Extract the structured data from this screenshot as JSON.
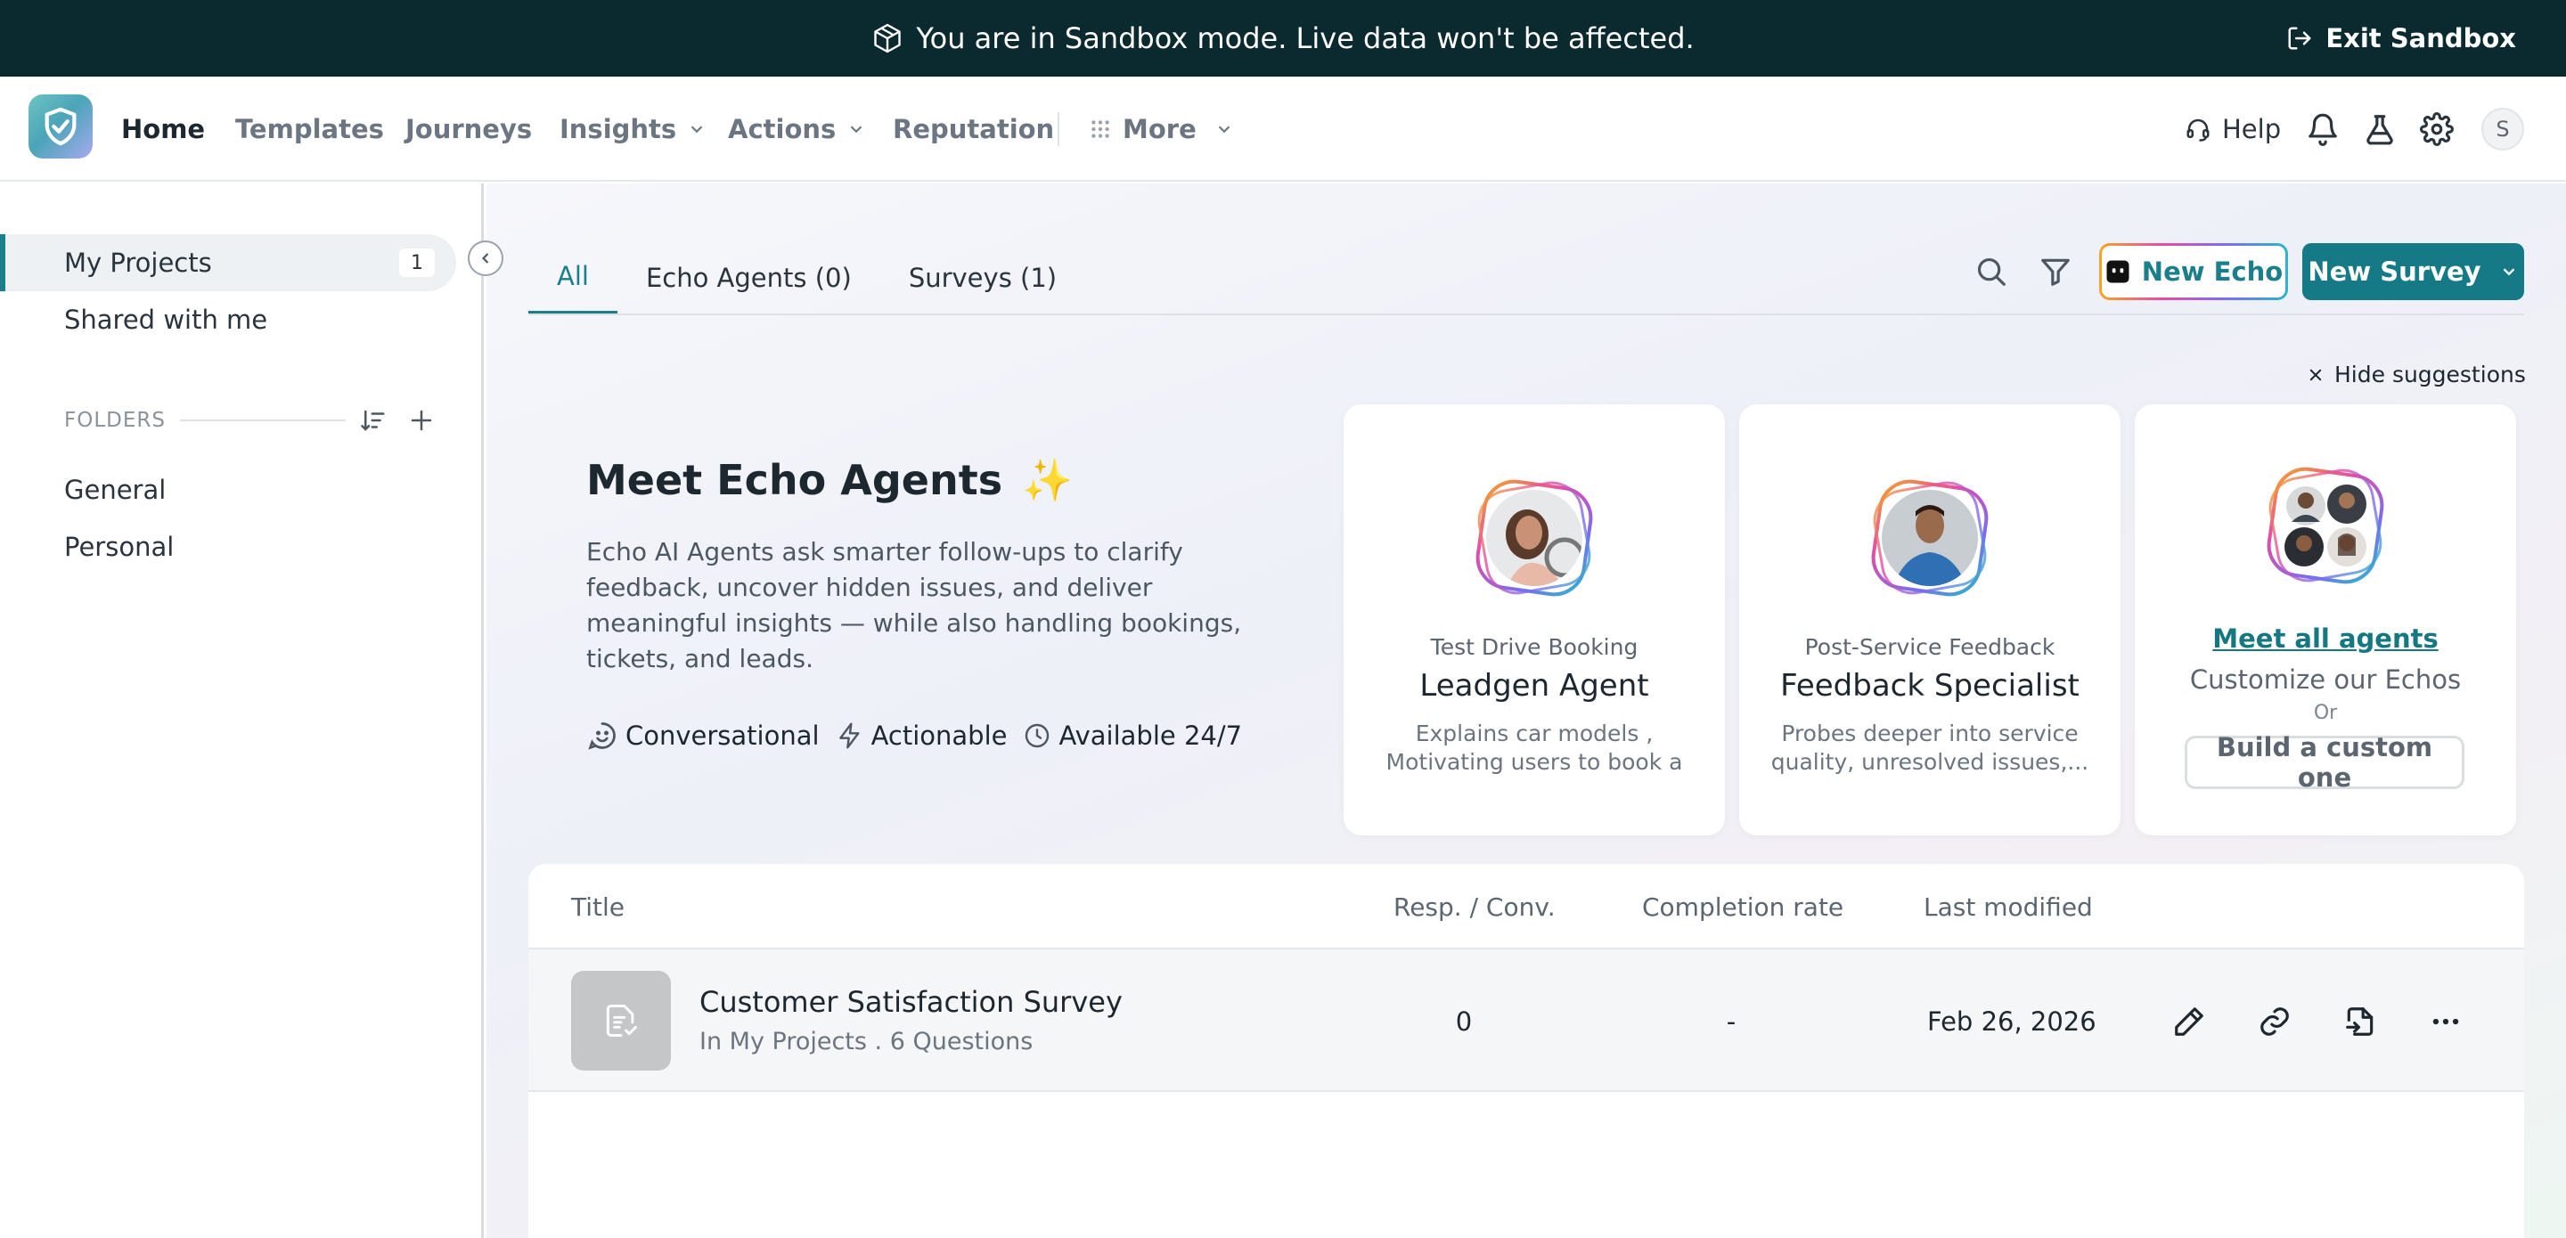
{
  "banner": {
    "message": "You are in Sandbox mode. Live data won't be affected.",
    "exit_label": "Exit Sandbox"
  },
  "nav": {
    "items": [
      {
        "label": "Home",
        "active": true
      },
      {
        "label": "Templates"
      },
      {
        "label": "Journeys"
      },
      {
        "label": "Insights",
        "dropdown": true
      },
      {
        "label": "Actions",
        "dropdown": true
      },
      {
        "label": "Reputation"
      },
      {
        "label": "More",
        "dropdown": true
      }
    ],
    "help_label": "Help",
    "user_initial": "S"
  },
  "sidebar": {
    "items": [
      {
        "label": "My Projects",
        "count": "1",
        "active": true
      },
      {
        "label": "Shared with me"
      }
    ],
    "folders_heading": "FOLDERS",
    "folders": [
      {
        "label": "General"
      },
      {
        "label": "Personal"
      }
    ]
  },
  "tabs": [
    {
      "label": "All",
      "active": true
    },
    {
      "label": "Echo Agents (0)"
    },
    {
      "label": "Surveys (1)"
    }
  ],
  "toolbar": {
    "new_echo_label": "New Echo",
    "new_survey_label": "New Survey"
  },
  "suggestions": {
    "hide_label": "Hide suggestions",
    "title": "Meet Echo Agents",
    "title_emoji": "✨",
    "description": "Echo AI Agents ask smarter follow-ups to clarify feedback, uncover hidden issues, and deliver meaningful insights — while also handling bookings, tickets, and leads.",
    "features": [
      "Conversational",
      "Actionable",
      "Available 24/7"
    ],
    "cards": [
      {
        "subtitle": "Test Drive Booking",
        "name": "Leadgen Agent",
        "description": "Explains car models , Motivating users to book a testdrive actin..."
      },
      {
        "subtitle": "Post-Service Feedback",
        "name": "Feedback Specialist",
        "description": "Probes deeper into service quality, unresolved issues,..."
      }
    ],
    "more_card": {
      "link_label": "Meet all agents",
      "customize_label": "Customize our Echos",
      "or_label": "Or",
      "build_label": "Build a custom one"
    }
  },
  "table": {
    "headers": {
      "title": "Title",
      "responses": "Resp. / Conv.",
      "completion": "Completion rate",
      "modified": "Last modified"
    },
    "rows": [
      {
        "title": "Customer Satisfaction Survey",
        "subtitle": "In My Projects . 6 Questions",
        "responses": "0",
        "completion": "-",
        "modified": "Feb 26, 2026"
      }
    ]
  },
  "colors": {
    "brand": "#157a86",
    "banner_bg": "#0b2a2f"
  }
}
